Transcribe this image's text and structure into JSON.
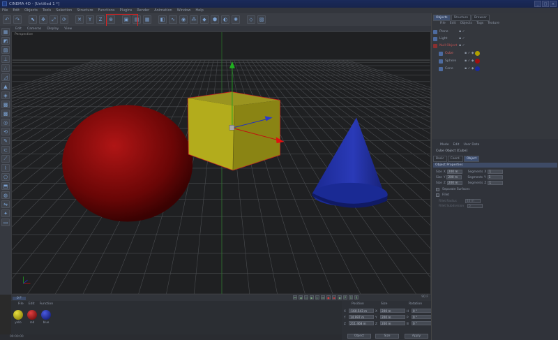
{
  "window": {
    "title": "CINEMA 4D - [Untitled 1 *]",
    "controls": [
      "_",
      "□",
      "×"
    ]
  },
  "menubar": [
    "File",
    "Edit",
    "Objects",
    "Tools",
    "Selection",
    "Structure",
    "Functions",
    "Plugins",
    "Render",
    "Animation",
    "Window",
    "Help"
  ],
  "viewport": {
    "menu": [
      "Edit",
      "Cameras",
      "Display",
      "View"
    ],
    "label": "Perspective"
  },
  "timeline": {
    "current_frame": "0 F",
    "end_frame": "90 F"
  },
  "materials": {
    "menu": [
      "File",
      "Edit",
      "Function"
    ],
    "items": [
      {
        "name": "yello",
        "color": "#b0a000"
      },
      {
        "name": "red",
        "color": "#a01010"
      },
      {
        "name": "blue",
        "color": "#1a2a9a"
      }
    ]
  },
  "status": {
    "time": "00:00:00"
  },
  "coords": {
    "headers": [
      "Position",
      "Size",
      "Rotation"
    ],
    "rows": [
      {
        "axis": [
          "X",
          "X",
          "H"
        ],
        "values": [
          "-160.543 m",
          "200 m",
          "0 °"
        ]
      },
      {
        "axis": [
          "Y",
          "Y",
          "P"
        ],
        "values": [
          "14.997 m",
          "200 m",
          "0 °"
        ]
      },
      {
        "axis": [
          "Z",
          "Z",
          "B"
        ],
        "values": [
          "211.468 m",
          "200 m",
          "0 °"
        ]
      }
    ],
    "buttons": [
      "Object",
      "Size",
      "Apply"
    ]
  },
  "object_manager": {
    "tabs": [
      "Objects",
      "Structure",
      "Browser"
    ],
    "menu": [
      "File",
      "Edit",
      "Objects",
      "Tags",
      "Texture"
    ],
    "objects": [
      {
        "name": "Plane",
        "indent": 0,
        "tag_color": ""
      },
      {
        "name": "Light",
        "indent": 0,
        "tag_color": ""
      },
      {
        "name": "Null Object",
        "indent": 0,
        "tag_color": ""
      },
      {
        "name": "Cube",
        "indent": 1,
        "tag_color": "#b0a000"
      },
      {
        "name": "Sphere",
        "indent": 1,
        "tag_color": "#a01010"
      },
      {
        "name": "Cone",
        "indent": 1,
        "tag_color": "#1a2a9a"
      }
    ]
  },
  "attributes": {
    "menu": [
      "Mode",
      "Edit",
      "User Data"
    ],
    "title": "Cube Object [Cube]",
    "tabs": [
      "Basic",
      "Coord.",
      "Object"
    ],
    "section": "Object Properties",
    "size_label": "Size",
    "segments_label": "Segments",
    "axes": [
      "X",
      "Y",
      "Z"
    ],
    "sizes": [
      "200 m",
      "200 m",
      "200 m"
    ],
    "segments": [
      "1",
      "1",
      "1"
    ],
    "separate_surfaces": "Separate Surfaces",
    "fillet": "Fillet",
    "fillet_radius_label": "Fillet Radius",
    "fillet_radius": "40 m",
    "fillet_subdiv_label": "Fillet Subdivision",
    "fillet_subdiv": "5"
  },
  "colors": {
    "cube": "#b3ac1c",
    "sphere": "#8a0a0a",
    "cone": "#1a2a9c",
    "highlight": "#e02020"
  }
}
